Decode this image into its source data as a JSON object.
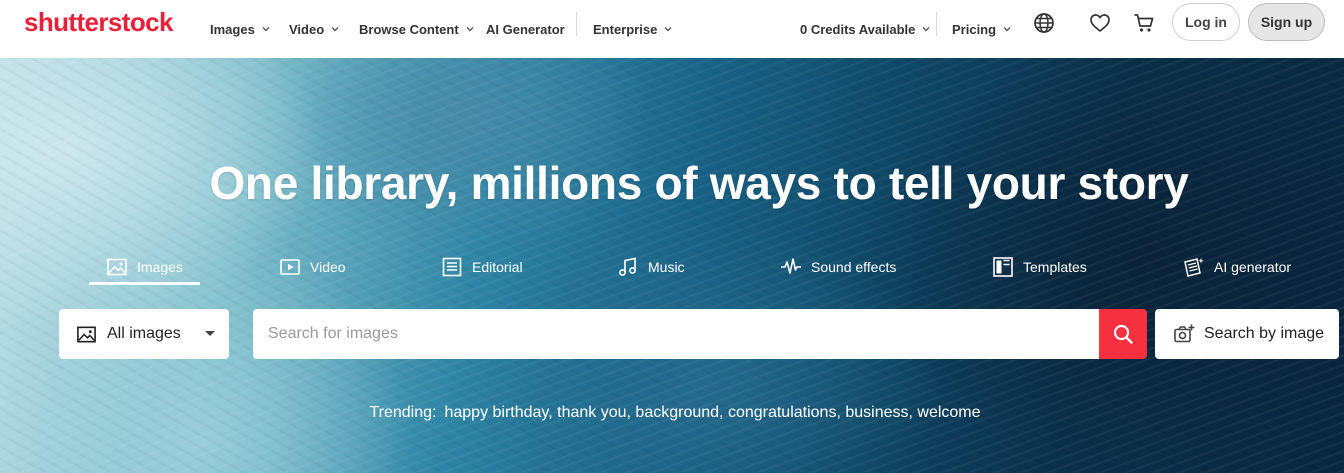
{
  "brand": {
    "logo_text": "shutterstock",
    "accent": "#e8213a",
    "search_button_color": "#f6303e"
  },
  "nav": {
    "items": [
      {
        "label": "Images",
        "has_dropdown": true
      },
      {
        "label": "Video",
        "has_dropdown": true
      },
      {
        "label": "Browse Content",
        "has_dropdown": true
      },
      {
        "label": "AI Generator",
        "has_dropdown": false
      },
      {
        "label": "Enterprise",
        "has_dropdown": true
      }
    ],
    "credits": "0 Credits Available",
    "pricing": "Pricing",
    "icons": [
      "globe-icon",
      "heart-icon",
      "cart-icon"
    ],
    "login": "Log in",
    "signup": "Sign up"
  },
  "hero": {
    "headline": "One library, millions of ways to tell your story",
    "tabs": [
      {
        "label": "Images",
        "icon": "image-icon",
        "active": true
      },
      {
        "label": "Video",
        "icon": "video-icon",
        "active": false
      },
      {
        "label": "Editorial",
        "icon": "editorial-icon",
        "active": false
      },
      {
        "label": "Music",
        "icon": "music-icon",
        "active": false
      },
      {
        "label": "Sound effects",
        "icon": "waveform-icon",
        "active": false
      },
      {
        "label": "Templates",
        "icon": "templates-icon",
        "active": false
      },
      {
        "label": "AI generator",
        "icon": "ai-generator-icon",
        "active": false
      }
    ],
    "search": {
      "asset_type": "All images",
      "placeholder": "Search for images",
      "value": "",
      "search_by_image": "Search by image"
    },
    "trending": {
      "label": "Trending:",
      "terms": [
        "happy birthday",
        "thank you",
        "background",
        "congratulations",
        "business",
        "welcome"
      ]
    }
  }
}
